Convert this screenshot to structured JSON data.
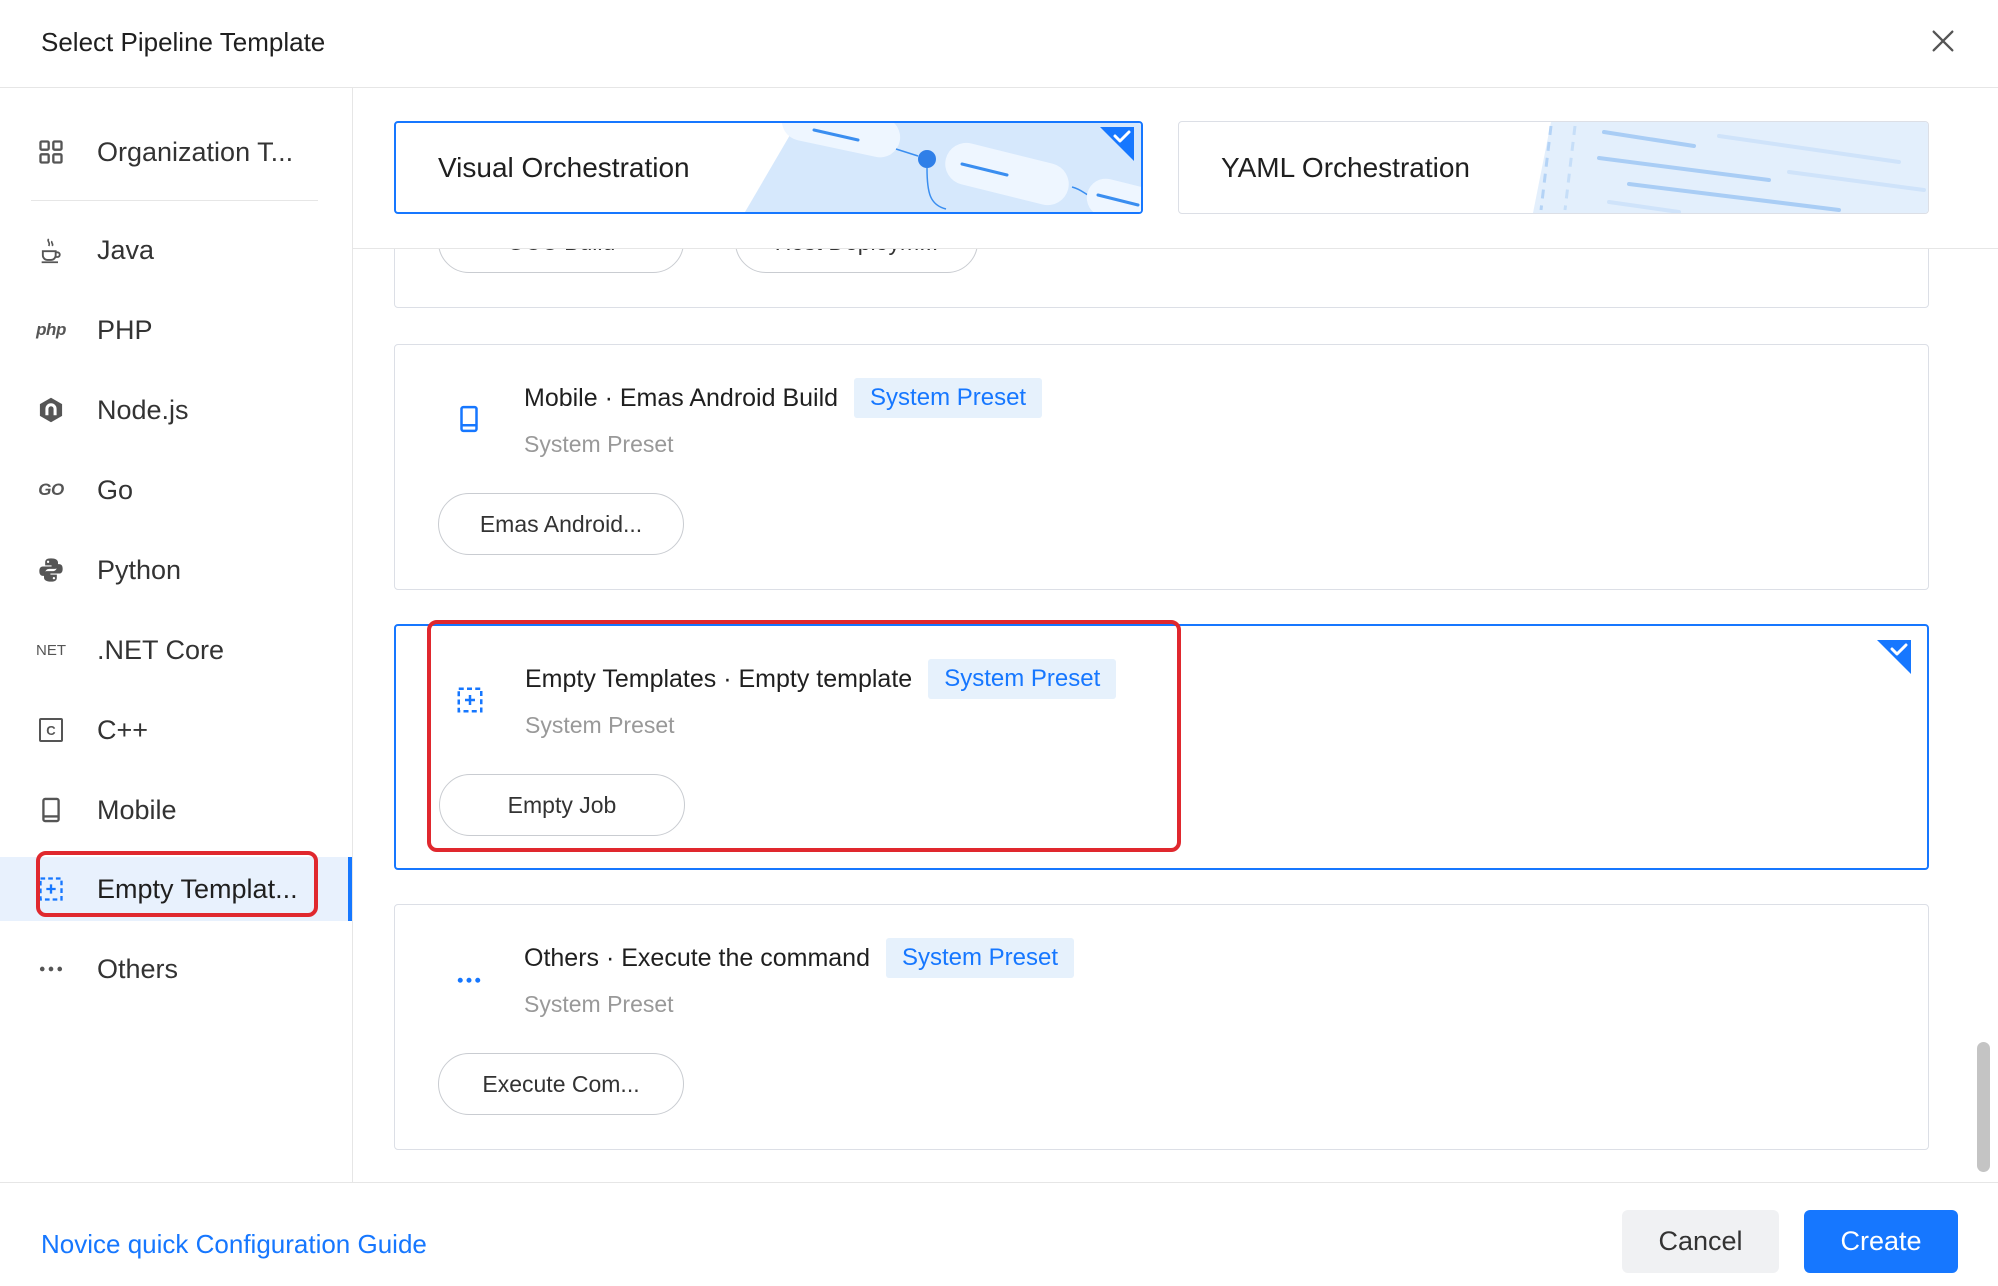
{
  "dialog": {
    "title": "Select Pipeline Template"
  },
  "sidebar": {
    "items": [
      {
        "label": "Organization T...",
        "icon": "grid-icon",
        "selected": false
      },
      {
        "label": "Java",
        "icon": "java-icon",
        "selected": false
      },
      {
        "label": "PHP",
        "icon": "php-icon",
        "icon_text": "php",
        "selected": false
      },
      {
        "label": "Node.js",
        "icon": "nodejs-icon",
        "selected": false
      },
      {
        "label": "Go",
        "icon": "go-icon",
        "icon_text": "GO",
        "selected": false
      },
      {
        "label": "Python",
        "icon": "python-icon",
        "selected": false
      },
      {
        "label": ".NET Core",
        "icon": "dotnet-icon",
        "icon_text": "NET",
        "selected": false
      },
      {
        "label": "C++",
        "icon": "cpp-icon",
        "icon_text": "C",
        "selected": false
      },
      {
        "label": "Mobile",
        "icon": "mobile-icon",
        "selected": false
      },
      {
        "label": "Empty Templat...",
        "icon": "empty-template-icon",
        "selected": true
      },
      {
        "label": "Others",
        "icon": "more-dots-icon",
        "selected": false
      }
    ]
  },
  "modes": [
    {
      "label": "Visual Orchestration",
      "selected": true
    },
    {
      "label": "YAML Orchestration",
      "selected": false
    }
  ],
  "templates": [
    {
      "chips": [
        "GCC Build",
        "Host Deploym..."
      ],
      "selected": false
    },
    {
      "icon": "mobile-icon",
      "title": "Mobile · Emas Android Build",
      "badge": "System Preset",
      "subtitle": "System Preset",
      "chips": [
        "Emas Android..."
      ],
      "selected": false
    },
    {
      "icon": "empty-template-icon",
      "title": "Empty Templates · Empty template",
      "badge": "System Preset",
      "subtitle": "System Preset",
      "chips": [
        "Empty Job"
      ],
      "selected": true
    },
    {
      "icon": "more-dots-icon",
      "title": "Others · Execute the command",
      "badge": "System Preset",
      "subtitle": "System Preset",
      "chips": [
        "Execute Com..."
      ],
      "selected": false
    }
  ],
  "footer": {
    "guide_link": "Novice quick Configuration Guide",
    "cancel_label": "Cancel",
    "create_label": "Create"
  },
  "colors": {
    "accent": "#1677ff",
    "annotation_red": "#e0282e",
    "selected_bg": "#e8f1fd",
    "badge_bg": "#e6f1fc"
  }
}
